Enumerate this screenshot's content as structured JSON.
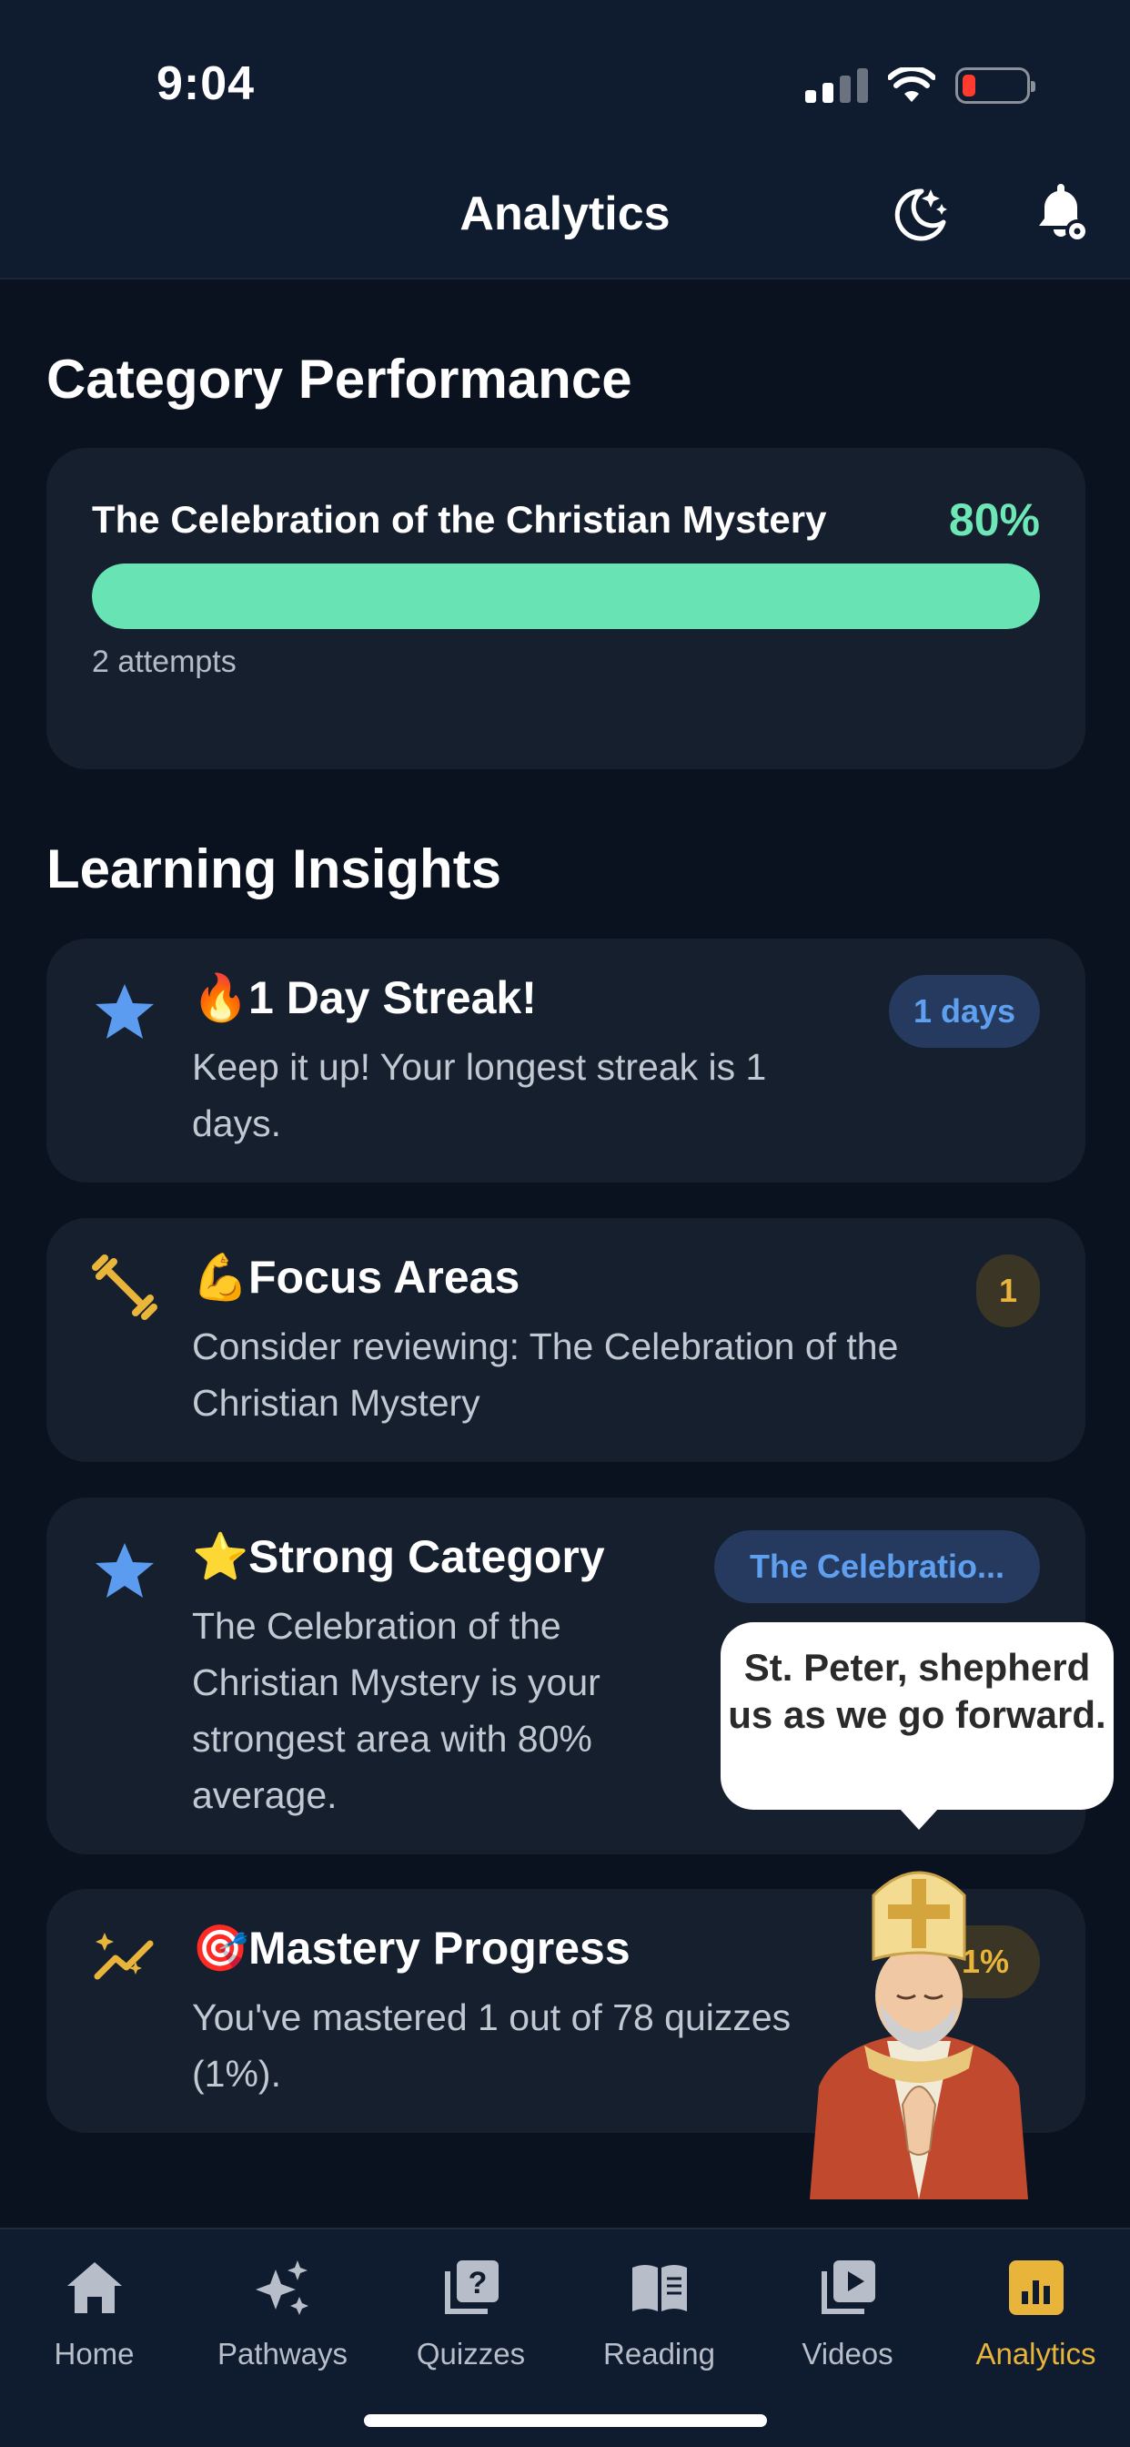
{
  "status_bar": {
    "time": "9:04"
  },
  "header": {
    "title": "Analytics",
    "icons": [
      "moon-stars-icon",
      "bell-gear-icon"
    ]
  },
  "category_performance": {
    "title": "Category Performance",
    "items": [
      {
        "name": "The Celebration of the Christian Mystery",
        "percent_label": "80%",
        "percent": 100,
        "attempts": "2 attempts"
      }
    ]
  },
  "learning_insights": {
    "title": "Learning Insights",
    "items": [
      {
        "icon": "star-icon",
        "emoji": "🔥",
        "title": "1 Day Streak!",
        "description": "Keep it up! Your longest streak is 1 days.",
        "badge": "1 days"
      },
      {
        "icon": "dumbbell-icon",
        "emoji": "💪",
        "title": "Focus Areas",
        "description": "Consider reviewing: The Celebration of the Christian Mystery",
        "badge": "1"
      },
      {
        "icon": "star-icon",
        "emoji": "⭐",
        "title": "Strong Category",
        "description": "The Celebration of the Christian Mystery is your strongest area with 80% average.",
        "badge": "The Celebratio..."
      },
      {
        "icon": "sparkle-trend-icon",
        "emoji": "🎯",
        "title": "Mastery Progress",
        "description": "You've mastered 1 out of 78 quizzes (1%).",
        "badge": "1%"
      }
    ]
  },
  "mascot": {
    "speech": "St. Peter, shepherd us as we go forward."
  },
  "tabs": [
    {
      "label": "Home",
      "icon": "home-icon",
      "active": false
    },
    {
      "label": "Pathways",
      "icon": "sparkles-icon",
      "active": false
    },
    {
      "label": "Quizzes",
      "icon": "quiz-question-icon",
      "active": false
    },
    {
      "label": "Reading",
      "icon": "book-icon",
      "active": false
    },
    {
      "label": "Videos",
      "icon": "video-library-icon",
      "active": false
    },
    {
      "label": "Analytics",
      "icon": "analytics-chart-icon",
      "active": true
    }
  ],
  "colors": {
    "accent_green": "#68e3b4",
    "accent_gold": "#e8b53a",
    "accent_blue": "#5ea0ef",
    "background": "#0b121f",
    "card": "#161f2e"
  }
}
